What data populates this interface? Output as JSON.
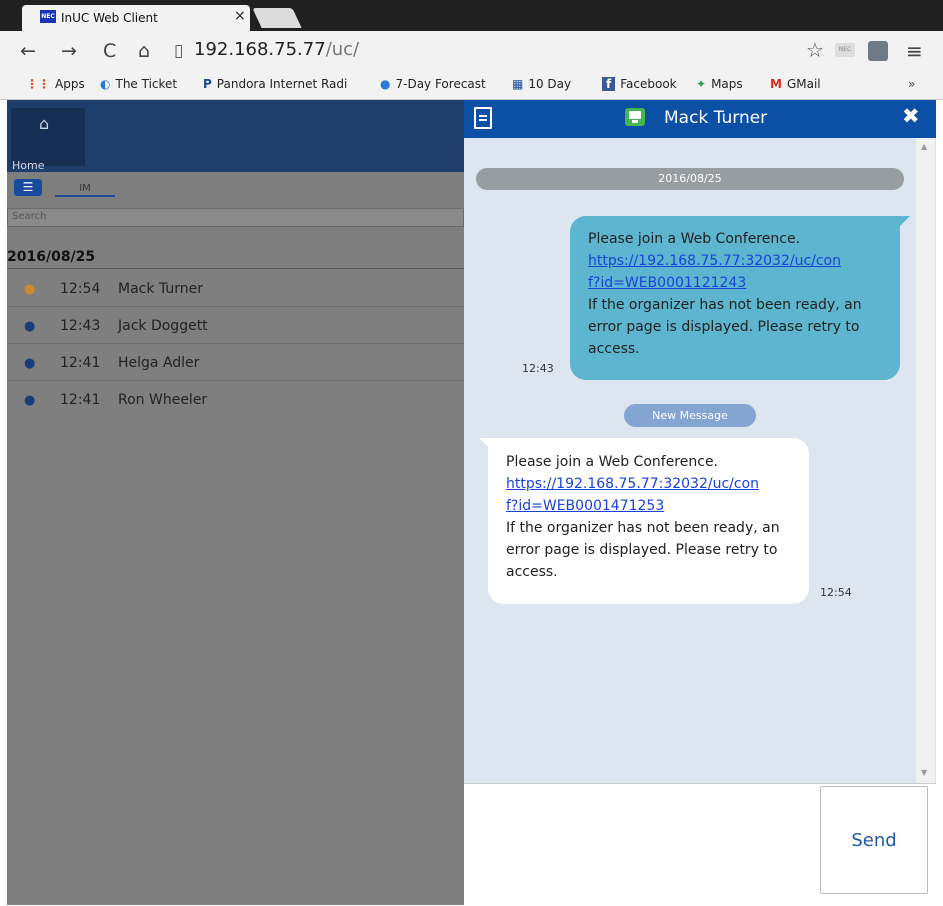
{
  "browser": {
    "tab_title": "InUC Web Client",
    "tab_favicon": "NEC",
    "tab_close": "×",
    "url_host": "192.168.75.77",
    "url_path": "/uc/",
    "ext1_label": "NEC",
    "bookmarks": [
      {
        "icon": "apps-icon",
        "glyph": "⋮⋮",
        "label": "Apps"
      },
      {
        "icon": "ticket-icon",
        "glyph": "◐",
        "label": "The Ticket"
      },
      {
        "icon": "pandora-icon",
        "glyph": "P",
        "label": "Pandora Internet Radi"
      },
      {
        "icon": "weather-icon",
        "glyph": "●",
        "label": "7-Day Forecast"
      },
      {
        "icon": "weather-channel-icon",
        "glyph": "▦",
        "label": "10 Day"
      },
      {
        "icon": "facebook-icon",
        "glyph": "f",
        "label": "Facebook"
      },
      {
        "icon": "maps-icon",
        "glyph": "✦",
        "label": "Maps"
      },
      {
        "icon": "gmail-icon",
        "glyph": "M",
        "label": "GMail"
      }
    ],
    "more": "»"
  },
  "left": {
    "home_label": "Home",
    "im_tab": "IM",
    "search_placeholder": "Search",
    "date_header": "2016/08/25",
    "conversations": [
      {
        "time": "12:54",
        "name": "Mack Turner",
        "unread": true
      },
      {
        "time": "12:43",
        "name": "Jack Doggett",
        "unread": false
      },
      {
        "time": "12:41",
        "name": "Helga Adler",
        "unread": false
      },
      {
        "time": "12:41",
        "name": "Ron Wheeler",
        "unread": false
      }
    ]
  },
  "chat": {
    "title": "Mack Turner",
    "date_divider": "2016/08/25",
    "outgoing": {
      "line1": "Please join a Web Conference.",
      "link": "https://192.168.75.77:32032/uc/conf?id=WEB0001121243",
      "link_part1": "https://192.168.75.77:32032/uc/con",
      "link_part2": "f?id=WEB0001121243",
      "line2": "If the organizer has not been ready, an error page is displayed. Please retry to access.",
      "time": "12:43"
    },
    "new_message_label": "New Message",
    "incoming": {
      "line1": "Please join a Web Conference.",
      "link": "https://192.168.75.77:32032/uc/conf?id=WEB0001471253",
      "link_part1": "https://192.168.75.77:32032/uc/con",
      "link_part2": "f?id=WEB0001471253",
      "line2": "If the organizer has not been ready, an error page is displayed. Please retry to access.",
      "time": "12:54"
    },
    "send_label": "Send"
  },
  "colors": {
    "header_blue": "#0b50a4",
    "outgoing_bubble": "#5db5d0",
    "unread_icon": "#d08a2a"
  }
}
